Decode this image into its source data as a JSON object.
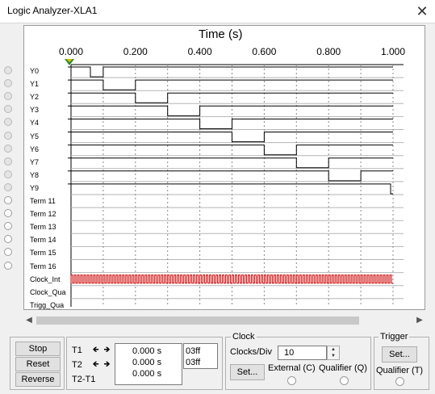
{
  "window": {
    "title": "Logic Analyzer-XLA1"
  },
  "plot": {
    "axis_title": "Time (s)",
    "ticks": [
      "0.000",
      "0.200",
      "0.400",
      "0.600",
      "0.800",
      "1.000"
    ],
    "channels": [
      "Y0",
      "Y1",
      "Y2",
      "Y3",
      "Y4",
      "Y5",
      "Y6",
      "Y7",
      "Y8",
      "Y9",
      "Term 11",
      "Term 12",
      "Term 13",
      "Term 14",
      "Term 15",
      "Term 16",
      "Clock_Int",
      "Clock_Qua",
      "Trigg_Qua"
    ]
  },
  "controls": {
    "stop": "Stop",
    "reset": "Reset",
    "reverse": "Reverse",
    "t1": "T1",
    "t2": "T2",
    "t2t1": "T2-T1",
    "t1_value": "0.000 s",
    "t2_value": "0.000 s",
    "t2t1_value": "0.000 s",
    "hex1": "03ff",
    "hex2": "03ff"
  },
  "clock": {
    "heading": "Clock",
    "clocks_div_label": "Clocks/Div",
    "clocks_div_value": "10",
    "set": "Set...",
    "external": "External (C)",
    "qualifier": "Qualifier (Q)"
  },
  "trigger": {
    "heading": "Trigger",
    "set": "Set...",
    "qualifier": "Qualifier (T)"
  },
  "colors": {
    "clock_trace": "#cc0000",
    "marker": "#2a8a2a"
  }
}
